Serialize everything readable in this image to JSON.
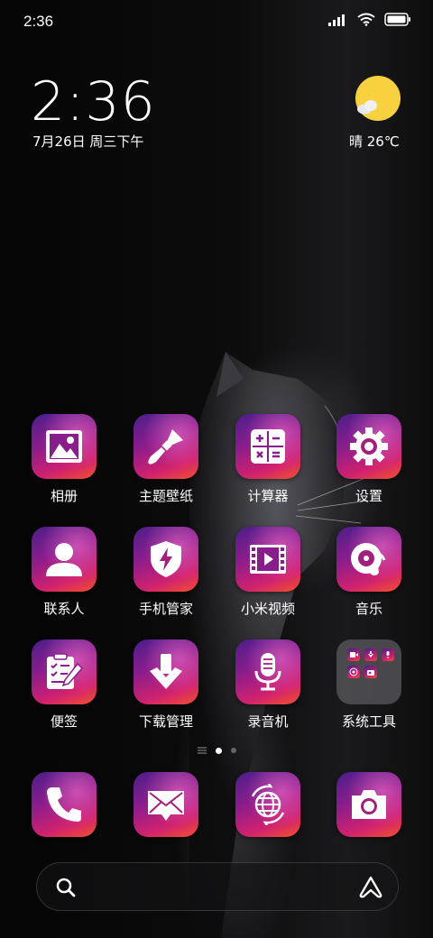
{
  "status_bar": {
    "time": "2:36"
  },
  "clock": {
    "time": "2:36",
    "date": "7月26日 周三下午"
  },
  "weather": {
    "text": "晴 26℃"
  },
  "rows": [
    [
      {
        "label": "相册",
        "icon": "gallery-icon"
      },
      {
        "label": "主题壁纸",
        "icon": "paintbrush-icon"
      },
      {
        "label": "计算器",
        "icon": "calculator-icon"
      },
      {
        "label": "设置",
        "icon": "gear-icon"
      }
    ],
    [
      {
        "label": "联系人",
        "icon": "person-icon"
      },
      {
        "label": "手机管家",
        "icon": "shield-bolt-icon"
      },
      {
        "label": "小米视频",
        "icon": "film-play-icon"
      },
      {
        "label": "音乐",
        "icon": "music-disc-icon"
      }
    ],
    [
      {
        "label": "便签",
        "icon": "notepad-pencil-icon"
      },
      {
        "label": "下载管理",
        "icon": "download-arrow-icon"
      },
      {
        "label": "录音机",
        "icon": "microphone-icon"
      },
      {
        "label": "系统工具",
        "icon": "folder-icon"
      }
    ]
  ],
  "dock": [
    {
      "icon": "phone-icon"
    },
    {
      "icon": "mail-icon"
    },
    {
      "icon": "browser-globe-icon"
    },
    {
      "icon": "camera-icon"
    }
  ],
  "search": {
    "left_icon": "search-icon",
    "right_icon": "assistant-icon"
  }
}
